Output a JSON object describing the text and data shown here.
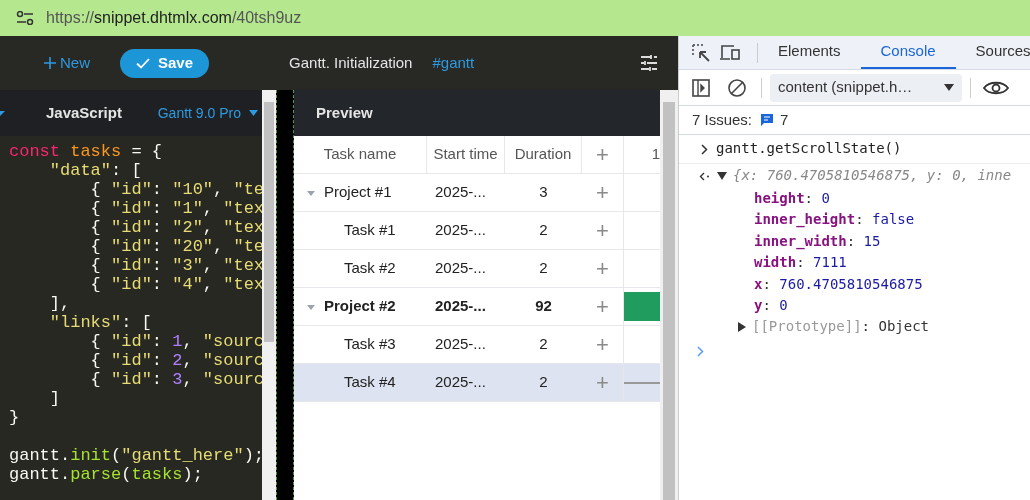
{
  "address_bar": {
    "url_prefix": "https://",
    "url_host": "snippet.dhtmlx.com",
    "url_path": "/40tsh9uz"
  },
  "toolbar": {
    "new_label": "New",
    "save_label": "Save",
    "title": "Gantt. Initialization",
    "tag": "#gantt"
  },
  "editor": {
    "tab": "JavaScript",
    "version": "Gantt 9.0 Pro",
    "code_blocks": [
      [
        [
          {
            "kind": "keyword",
            "t": "const"
          },
          {
            "kind": "var",
            "t": " tasks"
          },
          {
            "kind": "plain",
            "t": " = {"
          }
        ],
        [
          {
            "kind": "string",
            "t": "    \"data\""
          },
          {
            "kind": "plain",
            "t": ": ["
          }
        ],
        [
          {
            "kind": "plain",
            "t": "        { "
          },
          {
            "kind": "string",
            "t": "\"id\""
          },
          {
            "kind": "plain",
            "t": ": "
          },
          {
            "kind": "string",
            "t": "\"10\""
          },
          {
            "kind": "plain",
            "t": ", "
          },
          {
            "kind": "string",
            "t": "\"te"
          }
        ],
        [
          {
            "kind": "plain",
            "t": "        { "
          },
          {
            "kind": "string",
            "t": "\"id\""
          },
          {
            "kind": "plain",
            "t": ": "
          },
          {
            "kind": "string",
            "t": "\"1\""
          },
          {
            "kind": "plain",
            "t": ", "
          },
          {
            "kind": "string",
            "t": "\"tex"
          }
        ],
        [
          {
            "kind": "plain",
            "t": "        { "
          },
          {
            "kind": "string",
            "t": "\"id\""
          },
          {
            "kind": "plain",
            "t": ": "
          },
          {
            "kind": "string",
            "t": "\"2\""
          },
          {
            "kind": "plain",
            "t": ", "
          },
          {
            "kind": "string",
            "t": "\"tex"
          }
        ],
        [
          {
            "kind": "plain",
            "t": "        { "
          },
          {
            "kind": "string",
            "t": "\"id\""
          },
          {
            "kind": "plain",
            "t": ": "
          },
          {
            "kind": "string",
            "t": "\"20\""
          },
          {
            "kind": "plain",
            "t": ", "
          },
          {
            "kind": "string",
            "t": "\"te"
          }
        ],
        [
          {
            "kind": "plain",
            "t": "        { "
          },
          {
            "kind": "string",
            "t": "\"id\""
          },
          {
            "kind": "plain",
            "t": ": "
          },
          {
            "kind": "string",
            "t": "\"3\""
          },
          {
            "kind": "plain",
            "t": ", "
          },
          {
            "kind": "string",
            "t": "\"tex"
          }
        ],
        [
          {
            "kind": "plain",
            "t": "        { "
          },
          {
            "kind": "string",
            "t": "\"id\""
          },
          {
            "kind": "plain",
            "t": ": "
          },
          {
            "kind": "string",
            "t": "\"4\""
          },
          {
            "kind": "plain",
            "t": ", "
          },
          {
            "kind": "string",
            "t": "\"tex"
          }
        ],
        [
          {
            "kind": "plain",
            "t": "    ],"
          }
        ],
        [
          {
            "kind": "string",
            "t": "    \"links\""
          },
          {
            "kind": "plain",
            "t": ": ["
          }
        ],
        [
          {
            "kind": "plain",
            "t": "        { "
          },
          {
            "kind": "string",
            "t": "\"id\""
          },
          {
            "kind": "plain",
            "t": ": "
          },
          {
            "kind": "number",
            "t": "1"
          },
          {
            "kind": "plain",
            "t": ", "
          },
          {
            "kind": "string",
            "t": "\"sourc"
          }
        ],
        [
          {
            "kind": "plain",
            "t": "        { "
          },
          {
            "kind": "string",
            "t": "\"id\""
          },
          {
            "kind": "plain",
            "t": ": "
          },
          {
            "kind": "number",
            "t": "2"
          },
          {
            "kind": "plain",
            "t": ", "
          },
          {
            "kind": "string",
            "t": "\"sourc"
          }
        ],
        [
          {
            "kind": "plain",
            "t": "        { "
          },
          {
            "kind": "string",
            "t": "\"id\""
          },
          {
            "kind": "plain",
            "t": ": "
          },
          {
            "kind": "number",
            "t": "3"
          },
          {
            "kind": "plain",
            "t": ", "
          },
          {
            "kind": "string",
            "t": "\"sourc"
          }
        ],
        [
          {
            "kind": "plain",
            "t": "    ]"
          }
        ],
        [
          {
            "kind": "plain",
            "t": "}"
          }
        ]
      ],
      [
        [
          {
            "kind": "plain",
            "t": "gantt."
          },
          {
            "kind": "func",
            "t": "init"
          },
          {
            "kind": "plain",
            "t": "("
          },
          {
            "kind": "string",
            "t": "\"gantt_here\""
          },
          {
            "kind": "plain",
            "t": ");"
          }
        ],
        [
          {
            "kind": "plain",
            "t": "gantt."
          },
          {
            "kind": "func",
            "t": "parse"
          },
          {
            "kind": "plain",
            "t": "("
          },
          {
            "kind": "func",
            "t": "tasks"
          },
          {
            "kind": "plain",
            "t": ");"
          }
        ]
      ]
    ]
  },
  "preview": {
    "title": "Preview",
    "columns": [
      "Task name",
      "Start time",
      "Duration",
      "+"
    ],
    "timeline_header": "1",
    "rows": [
      {
        "name": "Project #1",
        "start": "2025-...",
        "duration": "3",
        "add": "+",
        "expanded": true,
        "bold": false,
        "selected": false,
        "kind": "plain",
        "children": [
          {
            "name": "Task #1",
            "start": "2025-...",
            "duration": "2",
            "add": "+",
            "bold": false,
            "selected": false,
            "kind": "plain"
          },
          {
            "name": "Task #2",
            "start": "2025-...",
            "duration": "2",
            "add": "+",
            "bold": false,
            "selected": false,
            "kind": "plain"
          }
        ]
      },
      {
        "name": "Project #2",
        "start": "2025-...",
        "duration": "92",
        "add": "+",
        "expanded": true,
        "bold": true,
        "selected": false,
        "kind": "bar",
        "children": [
          {
            "name": "Task #3",
            "start": "2025-...",
            "duration": "2",
            "add": "+",
            "bold": false,
            "selected": false,
            "kind": "plain"
          },
          {
            "name": "Task #4",
            "start": "2025-...",
            "duration": "2",
            "add": "+",
            "bold": false,
            "selected": true,
            "kind": "line"
          }
        ]
      }
    ]
  },
  "devtools": {
    "tabs": [
      {
        "label": "Elements",
        "selected": false
      },
      {
        "label": "Console",
        "selected": true
      },
      {
        "label": "Sources",
        "selected": false
      }
    ],
    "context": "content (snippet.h…",
    "issues_label": "7 Issues:",
    "issues_count": "7",
    "command": "gantt.getScrollState()",
    "result_summary": "{x: 760.4705810546875, y: 0, inne",
    "properties": [
      {
        "key": "height",
        "sep": ":",
        "value": "0"
      },
      {
        "key": "inner_height",
        "sep": ":",
        "value": "false"
      },
      {
        "key": "inner_width",
        "sep": ":",
        "value": "15"
      },
      {
        "key": "width",
        "sep": ":",
        "value": "7111"
      },
      {
        "key": "x",
        "sep": ":",
        "value": "760.4705810546875"
      },
      {
        "key": "y",
        "sep": ":",
        "value": "0"
      }
    ],
    "prototype_key": "[[Prototype]]",
    "prototype_sep": ":",
    "prototype_value": "Object"
  }
}
